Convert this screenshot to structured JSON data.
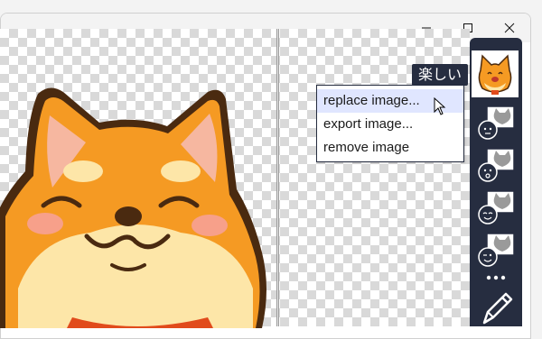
{
  "window": {
    "controls": [
      {
        "name": "minimize",
        "icon": "minimize-icon"
      },
      {
        "name": "maximize",
        "icon": "maximize-icon"
      },
      {
        "name": "close",
        "icon": "close-icon"
      }
    ]
  },
  "tooltip": {
    "text": "楽しい"
  },
  "context_menu": {
    "items": [
      {
        "label": "replace image...",
        "hovered": true
      },
      {
        "label": "export image..."
      },
      {
        "label": "remove image"
      }
    ]
  },
  "sidebar": {
    "thumbnails": [
      {
        "icon": "shiba-happy-icon",
        "selected": true
      },
      {
        "icon": "cat-neutral-icon"
      },
      {
        "icon": "cat-surprised-icon"
      },
      {
        "icon": "cat-smile-icon"
      },
      {
        "icon": "cat-wink-icon"
      }
    ],
    "more_icon": "more-dots-icon",
    "edit_icon": "pencil-icon"
  },
  "colors": {
    "sidebar_bg": "#262d40",
    "menu_hover": "#e0e6ff",
    "shiba_orange": "#f59a23",
    "shiba_cream": "#fde6a8"
  }
}
